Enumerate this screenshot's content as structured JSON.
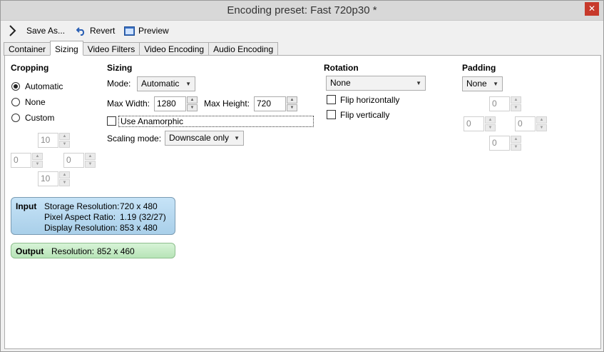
{
  "window": {
    "title": "Encoding preset: Fast 720p30 *",
    "close_glyph": "✕"
  },
  "toolbar": {
    "save_as_label": "Save As...",
    "revert_label": "Revert",
    "preview_label": "Preview",
    "expand_icon": "chevron-right-icon",
    "revert_icon": "undo-icon",
    "preview_icon": "preview-icon"
  },
  "tabs": [
    "Container",
    "Sizing",
    "Video Filters",
    "Video Encoding",
    "Audio Encoding"
  ],
  "active_tab": "Sizing",
  "cropping": {
    "heading": "Cropping",
    "options": [
      "Automatic",
      "None",
      "Custom"
    ],
    "selected": "Automatic",
    "top": "10",
    "left": "0",
    "right": "0",
    "bottom": "10"
  },
  "sizing": {
    "heading": "Sizing",
    "mode_label": "Mode:",
    "mode_value": "Automatic",
    "max_width_label": "Max Width:",
    "max_width_value": "1280",
    "max_height_label": "Max Height:",
    "max_height_value": "720",
    "anamorphic_label": "Use Anamorphic",
    "anamorphic_checked": false,
    "scaling_mode_label": "Scaling mode:",
    "scaling_mode_value": "Downscale only"
  },
  "rotation": {
    "heading": "Rotation",
    "value": "None",
    "flip_horizontal_label": "Flip horizontally",
    "flip_vertical_label": "Flip vertically"
  },
  "padding": {
    "heading": "Padding",
    "value": "None",
    "top": "0",
    "left": "0",
    "right": "0",
    "bottom": "0"
  },
  "input_info": {
    "heading": "Input",
    "storage_label": "Storage Resolution:",
    "storage_value": "720 x 480",
    "par_label": "Pixel Aspect Ratio:",
    "par_value": "1.19 (32/27)",
    "display_label": "Display Resolution:",
    "display_value": "853 x 480"
  },
  "output_info": {
    "heading": "Output",
    "resolution_label": "Resolution:",
    "resolution_value": "852 x 460"
  },
  "colors": {
    "title_bar": "#d8d8d8",
    "close_button": "#c7392b",
    "input_box": "#b8d9f0",
    "output_box": "#c4ebc4"
  }
}
